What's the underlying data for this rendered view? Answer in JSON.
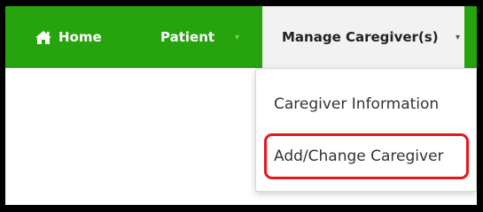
{
  "navbar": {
    "background": "#26a30d",
    "home": {
      "label": "Home",
      "icon": "home-icon"
    },
    "patient": {
      "label": "Patient",
      "caret": "▾"
    },
    "manage": {
      "label": "Manage Caregiver(s)",
      "caret": "▾"
    }
  },
  "dropdown": {
    "items": [
      {
        "label": "Caregiver Information"
      },
      {
        "label": "Add/Change Caregiver",
        "highlight_color": "#e8151b"
      }
    ]
  }
}
